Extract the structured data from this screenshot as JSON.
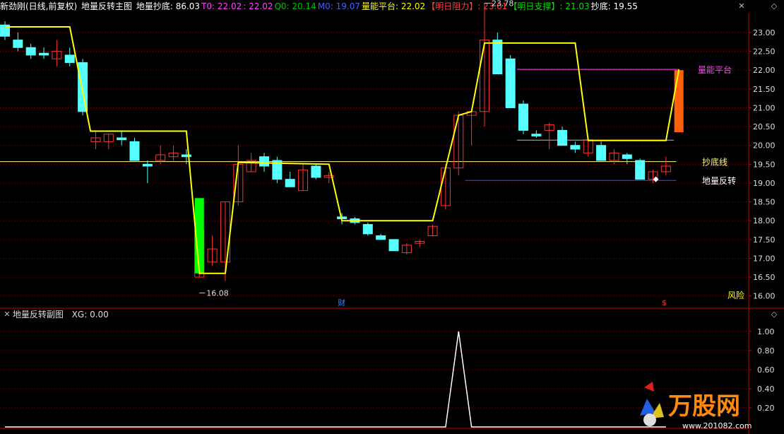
{
  "header": {
    "stock": "新劲刚(日线,前复权)",
    "indicator_name": "地量反转主图",
    "items": [
      {
        "label": "地量抄底: ",
        "value": "86.03",
        "color": "#ffffff"
      },
      {
        "label": "T0: ",
        "value": "22.02",
        "color": "#ff40ff"
      },
      {
        "label": ": ",
        "value": "22.02",
        "color": "#ff40ff"
      },
      {
        "label": "Q0: ",
        "value": "20.14",
        "color": "#00c000"
      },
      {
        "label": "M0: ",
        "value": "19.07",
        "color": "#4060ff"
      },
      {
        "label": "量能平台: ",
        "value": "22.02",
        "color": "#ffff00"
      },
      {
        "label": "【明日阻力】: ",
        "value": "23.01",
        "color": "#ff4040"
      },
      {
        "label": "【明日支撑】: ",
        "value": "21.03",
        "color": "#00e000"
      },
      {
        "label": "抄底: ",
        "value": "19.55",
        "color": "#ffffff"
      }
    ]
  },
  "controls": {
    "close": "✕",
    "expand": "◇"
  },
  "chart_data": [
    {
      "type": "candlestick",
      "title": "地量反转主图",
      "ylim": [
        15.75,
        23.3
      ],
      "y_ticks": [
        "23.00",
        "22.50",
        "22.00",
        "21.50",
        "21.00",
        "20.50",
        "20.00",
        "19.50",
        "19.00",
        "18.50",
        "18.00",
        "17.50",
        "17.00",
        "16.50",
        "16.00"
      ],
      "candles": [
        {
          "o": 23.2,
          "h": 23.3,
          "l": 22.8,
          "c": 22.9
        },
        {
          "o": 22.8,
          "h": 23.0,
          "l": 22.5,
          "c": 22.6
        },
        {
          "o": 22.6,
          "h": 22.7,
          "l": 22.3,
          "c": 22.4
        },
        {
          "o": 22.45,
          "h": 22.6,
          "l": 22.3,
          "c": 22.4
        },
        {
          "o": 22.3,
          "h": 22.8,
          "l": 22.1,
          "c": 22.5
        },
        {
          "o": 22.4,
          "h": 22.6,
          "l": 22.1,
          "c": 22.2
        },
        {
          "o": 22.2,
          "h": 22.3,
          "l": 20.8,
          "c": 20.9
        },
        {
          "o": 20.1,
          "h": 20.4,
          "l": 19.9,
          "c": 20.2
        },
        {
          "o": 20.1,
          "h": 20.3,
          "l": 19.9,
          "c": 20.3
        },
        {
          "o": 20.2,
          "h": 20.4,
          "l": 20.0,
          "c": 20.15
        },
        {
          "o": 20.1,
          "h": 20.2,
          "l": 19.6,
          "c": 19.6
        },
        {
          "o": 19.5,
          "h": 19.6,
          "l": 19.0,
          "c": 19.45
        },
        {
          "o": 19.6,
          "h": 20.0,
          "l": 19.5,
          "c": 19.75
        },
        {
          "o": 19.7,
          "h": 20.0,
          "l": 19.6,
          "c": 19.8
        },
        {
          "o": 19.75,
          "h": 19.9,
          "l": 19.5,
          "c": 19.7
        },
        {
          "o": 16.5,
          "h": 17.8,
          "l": 16.5,
          "c": 17.75
        },
        {
          "o": 16.9,
          "h": 17.6,
          "l": 16.8,
          "c": 17.25
        },
        {
          "o": 16.9,
          "h": 18.5,
          "l": 16.4,
          "c": 18.5
        },
        {
          "o": 18.5,
          "h": 20.0,
          "l": 18.4,
          "c": 19.5
        },
        {
          "o": 19.3,
          "h": 19.8,
          "l": 19.3,
          "c": 19.6
        },
        {
          "o": 19.7,
          "h": 19.8,
          "l": 19.3,
          "c": 19.45
        },
        {
          "o": 19.6,
          "h": 19.7,
          "l": 19.0,
          "c": 19.1
        },
        {
          "o": 19.1,
          "h": 19.3,
          "l": 18.9,
          "c": 18.9
        },
        {
          "o": 18.8,
          "h": 19.5,
          "l": 18.8,
          "c": 19.35
        },
        {
          "o": 19.45,
          "h": 19.5,
          "l": 19.1,
          "c": 19.15
        },
        {
          "o": 19.15,
          "h": 19.3,
          "l": 19.0,
          "c": 19.2
        },
        {
          "o": 18.1,
          "h": 18.2,
          "l": 17.9,
          "c": 18.05
        },
        {
          "o": 18.05,
          "h": 18.1,
          "l": 17.9,
          "c": 17.95
        },
        {
          "o": 17.9,
          "h": 17.95,
          "l": 17.6,
          "c": 17.65
        },
        {
          "o": 17.6,
          "h": 17.65,
          "l": 17.5,
          "c": 17.5
        },
        {
          "o": 17.5,
          "h": 17.5,
          "l": 17.2,
          "c": 17.2
        },
        {
          "o": 17.15,
          "h": 17.4,
          "l": 17.1,
          "c": 17.35
        },
        {
          "o": 17.4,
          "h": 17.5,
          "l": 17.3,
          "c": 17.45
        },
        {
          "o": 17.6,
          "h": 17.9,
          "l": 17.6,
          "c": 17.85
        },
        {
          "o": 18.4,
          "h": 19.5,
          "l": 18.3,
          "c": 19.4
        },
        {
          "o": 19.4,
          "h": 20.9,
          "l": 19.2,
          "c": 20.8
        },
        {
          "o": 20.8,
          "h": 20.9,
          "l": 20.0,
          "c": 20.9
        },
        {
          "o": 20.9,
          "h": 23.78,
          "l": 20.5,
          "c": 22.8
        },
        {
          "o": 22.8,
          "h": 23.0,
          "l": 21.9,
          "c": 21.9
        },
        {
          "o": 22.3,
          "h": 22.4,
          "l": 21.0,
          "c": 21.0
        },
        {
          "o": 21.1,
          "h": 21.2,
          "l": 20.3,
          "c": 20.4
        },
        {
          "o": 20.3,
          "h": 20.4,
          "l": 20.2,
          "c": 20.25
        },
        {
          "o": 20.4,
          "h": 20.6,
          "l": 19.9,
          "c": 20.55
        },
        {
          "o": 20.4,
          "h": 20.5,
          "l": 20.0,
          "c": 20.0
        },
        {
          "o": 20.0,
          "h": 20.1,
          "l": 19.8,
          "c": 19.9
        },
        {
          "o": 19.8,
          "h": 20.2,
          "l": 19.7,
          "c": 20.15
        },
        {
          "o": 20.0,
          "h": 20.1,
          "l": 19.6,
          "c": 19.6
        },
        {
          "o": 19.6,
          "h": 19.9,
          "l": 19.5,
          "c": 19.8
        },
        {
          "o": 19.75,
          "h": 19.8,
          "l": 19.5,
          "c": 19.65
        },
        {
          "o": 19.6,
          "h": 19.65,
          "l": 19.1,
          "c": 19.1
        },
        {
          "o": 19.1,
          "h": 19.35,
          "l": 19.0,
          "c": 19.3
        },
        {
          "o": 19.3,
          "h": 19.7,
          "l": 19.2,
          "c": 19.45
        }
      ],
      "special_bars": [
        {
          "index": 15,
          "o": 16.6,
          "c": 18.6,
          "color": "#00ff00"
        },
        {
          "index": 52,
          "o": 20.35,
          "c": 22.0,
          "color": "#ff6010"
        }
      ],
      "platform_line": [
        {
          "x": 0,
          "y": 23.15
        },
        {
          "x": 5,
          "y": 23.15
        },
        {
          "x": 6.6,
          "y": 20.38
        },
        {
          "x": 14,
          "y": 20.38
        },
        {
          "x": 15,
          "y": 16.6
        },
        {
          "x": 17,
          "y": 16.6
        },
        {
          "x": 18,
          "y": 19.55
        },
        {
          "x": 25,
          "y": 19.5
        },
        {
          "x": 26,
          "y": 18.0
        },
        {
          "x": 33,
          "y": 18.0
        },
        {
          "x": 35,
          "y": 20.8
        },
        {
          "x": 36,
          "y": 20.9
        },
        {
          "x": 37,
          "y": 22.72
        },
        {
          "x": 44,
          "y": 22.72
        },
        {
          "x": 45,
          "y": 20.13
        },
        {
          "x": 51,
          "y": 20.13
        },
        {
          "x": 52,
          "y": 22.02
        }
      ],
      "ref_lines": [
        {
          "name": "抄底线",
          "y": 19.57,
          "x_start": -0.5,
          "x_end": 51.8,
          "color": "#ffff88",
          "label": "抄底线"
        },
        {
          "name": "地量反转",
          "y": 19.07,
          "x_start": 35.5,
          "x_end": 51.8,
          "color": "#3050ff",
          "label": "地量反转"
        },
        {
          "name": "量能平台",
          "y": 22.02,
          "x_start": 39.5,
          "x_end": 52,
          "color": "#ff40ff",
          "label": "量能平台"
        }
      ],
      "support_tick": {
        "y": 20.14,
        "x_start": 39.5,
        "x_end": 51.6
      },
      "annotations": [
        {
          "text": "23.78",
          "x": 37,
          "y": 23.78
        },
        {
          "text": "16.08",
          "x": 15,
          "y": 16.08
        }
      ],
      "markers": [
        {
          "text": "财",
          "x": 26,
          "color": "#3080ff"
        },
        {
          "text": "$",
          "x": 51,
          "color": "#ff3030"
        }
      ],
      "diamond": {
        "x": 50,
        "y": 19.1
      },
      "risk_label": "风险"
    },
    {
      "type": "line",
      "title": "地量反转副图",
      "series": [
        {
          "name": "XG",
          "value_text": "0.00",
          "peak_index": 35,
          "peak_value": 1.0
        }
      ],
      "ylim": [
        0,
        1.08
      ],
      "y_ticks": [
        "1.00",
        "0.80",
        "0.60",
        "0.40",
        "0.20"
      ]
    }
  ],
  "sub_header": {
    "title": "地量反转副图",
    "xg_label": "XG: ",
    "xg_value": "0.00"
  },
  "watermark": {
    "brand": "万股网",
    "url": "www.201082.com"
  },
  "colors": {
    "up": "#ff3030",
    "down": "#55ffff",
    "grid": "#8a0000",
    "axis": "#c00000",
    "platform": "#ffff00"
  }
}
